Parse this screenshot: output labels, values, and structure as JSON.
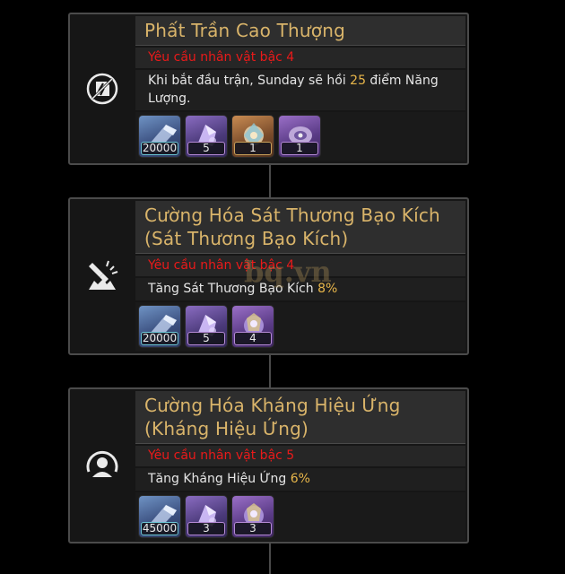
{
  "cards": [
    {
      "icon": "energy-shield-icon",
      "title": "Phất Trần Cao Thượng",
      "requirement": "Yêu cầu nhân vật bậc 4",
      "desc_before": "Khi bắt đầu trận, Sunday sẽ hồi ",
      "desc_highlight": "25",
      "desc_after": " điểm Năng Lượng.",
      "materials": [
        {
          "name": "exp-material-icon",
          "qty": "20000",
          "tint": "blue"
        },
        {
          "name": "purple-crystal-icon",
          "qty": "5",
          "tint": "purple"
        },
        {
          "name": "gold-relic-icon",
          "qty": "1",
          "tint": "gold"
        },
        {
          "name": "tracks-of-destiny-icon",
          "qty": "1",
          "tint": "violet"
        }
      ]
    },
    {
      "icon": "crit-damage-icon",
      "title": "Cường Hóa Sát Thương Bạo Kích (Sát Thương Bạo Kích)",
      "requirement": "Yêu cầu nhân vật bậc 4",
      "desc_before": "Tăng Sát Thương Bạo Kích ",
      "desc_highlight": "8%",
      "desc_after": "",
      "materials": [
        {
          "name": "exp-material-icon",
          "qty": "20000",
          "tint": "blue"
        },
        {
          "name": "purple-crystal-icon",
          "qty": "5",
          "tint": "purple"
        },
        {
          "name": "violet-orb-icon",
          "qty": "4",
          "tint": "violet"
        }
      ]
    },
    {
      "icon": "effect-res-icon",
      "title": "Cường Hóa Kháng Hiệu Ứng (Kháng Hiệu Ứng)",
      "requirement": "Yêu cầu nhân vật bậc 5",
      "desc_before": "Tăng Kháng Hiệu Ứng ",
      "desc_highlight": "6%",
      "desc_after": "",
      "materials": [
        {
          "name": "exp-material-icon",
          "qty": "45000",
          "tint": "blue"
        },
        {
          "name": "purple-crystal-icon",
          "qty": "3",
          "tint": "purple"
        },
        {
          "name": "violet-orb-icon",
          "qty": "3",
          "tint": "violet"
        }
      ]
    }
  ],
  "watermark": "bq.vn"
}
